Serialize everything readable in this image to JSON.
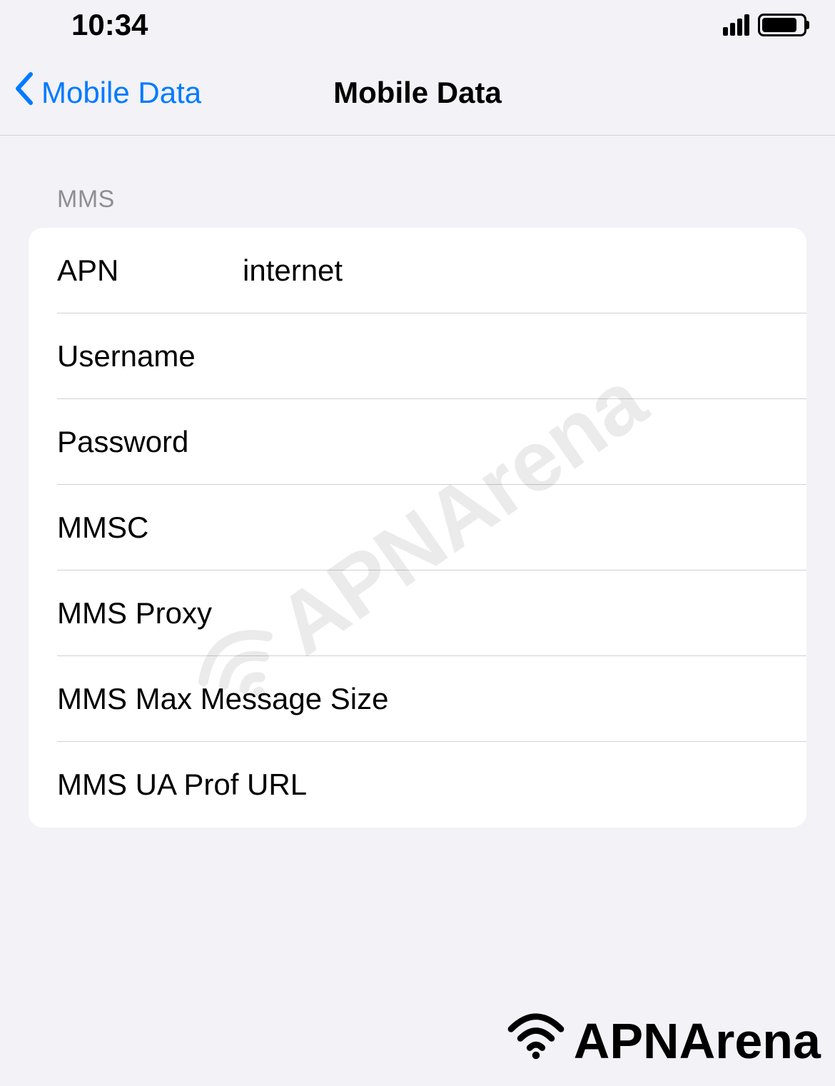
{
  "statusBar": {
    "time": "10:34"
  },
  "navBar": {
    "backLabel": "Mobile Data",
    "title": "Mobile Data"
  },
  "section": {
    "header": "MMS",
    "rows": [
      {
        "label": "APN",
        "value": "internet"
      },
      {
        "label": "Username",
        "value": ""
      },
      {
        "label": "Password",
        "value": ""
      },
      {
        "label": "MMSC",
        "value": ""
      },
      {
        "label": "MMS Proxy",
        "value": ""
      },
      {
        "label": "MMS Max Message Size",
        "value": ""
      },
      {
        "label": "MMS UA Prof URL",
        "value": ""
      }
    ]
  },
  "watermark": "APNArena",
  "brand": "APNArena"
}
